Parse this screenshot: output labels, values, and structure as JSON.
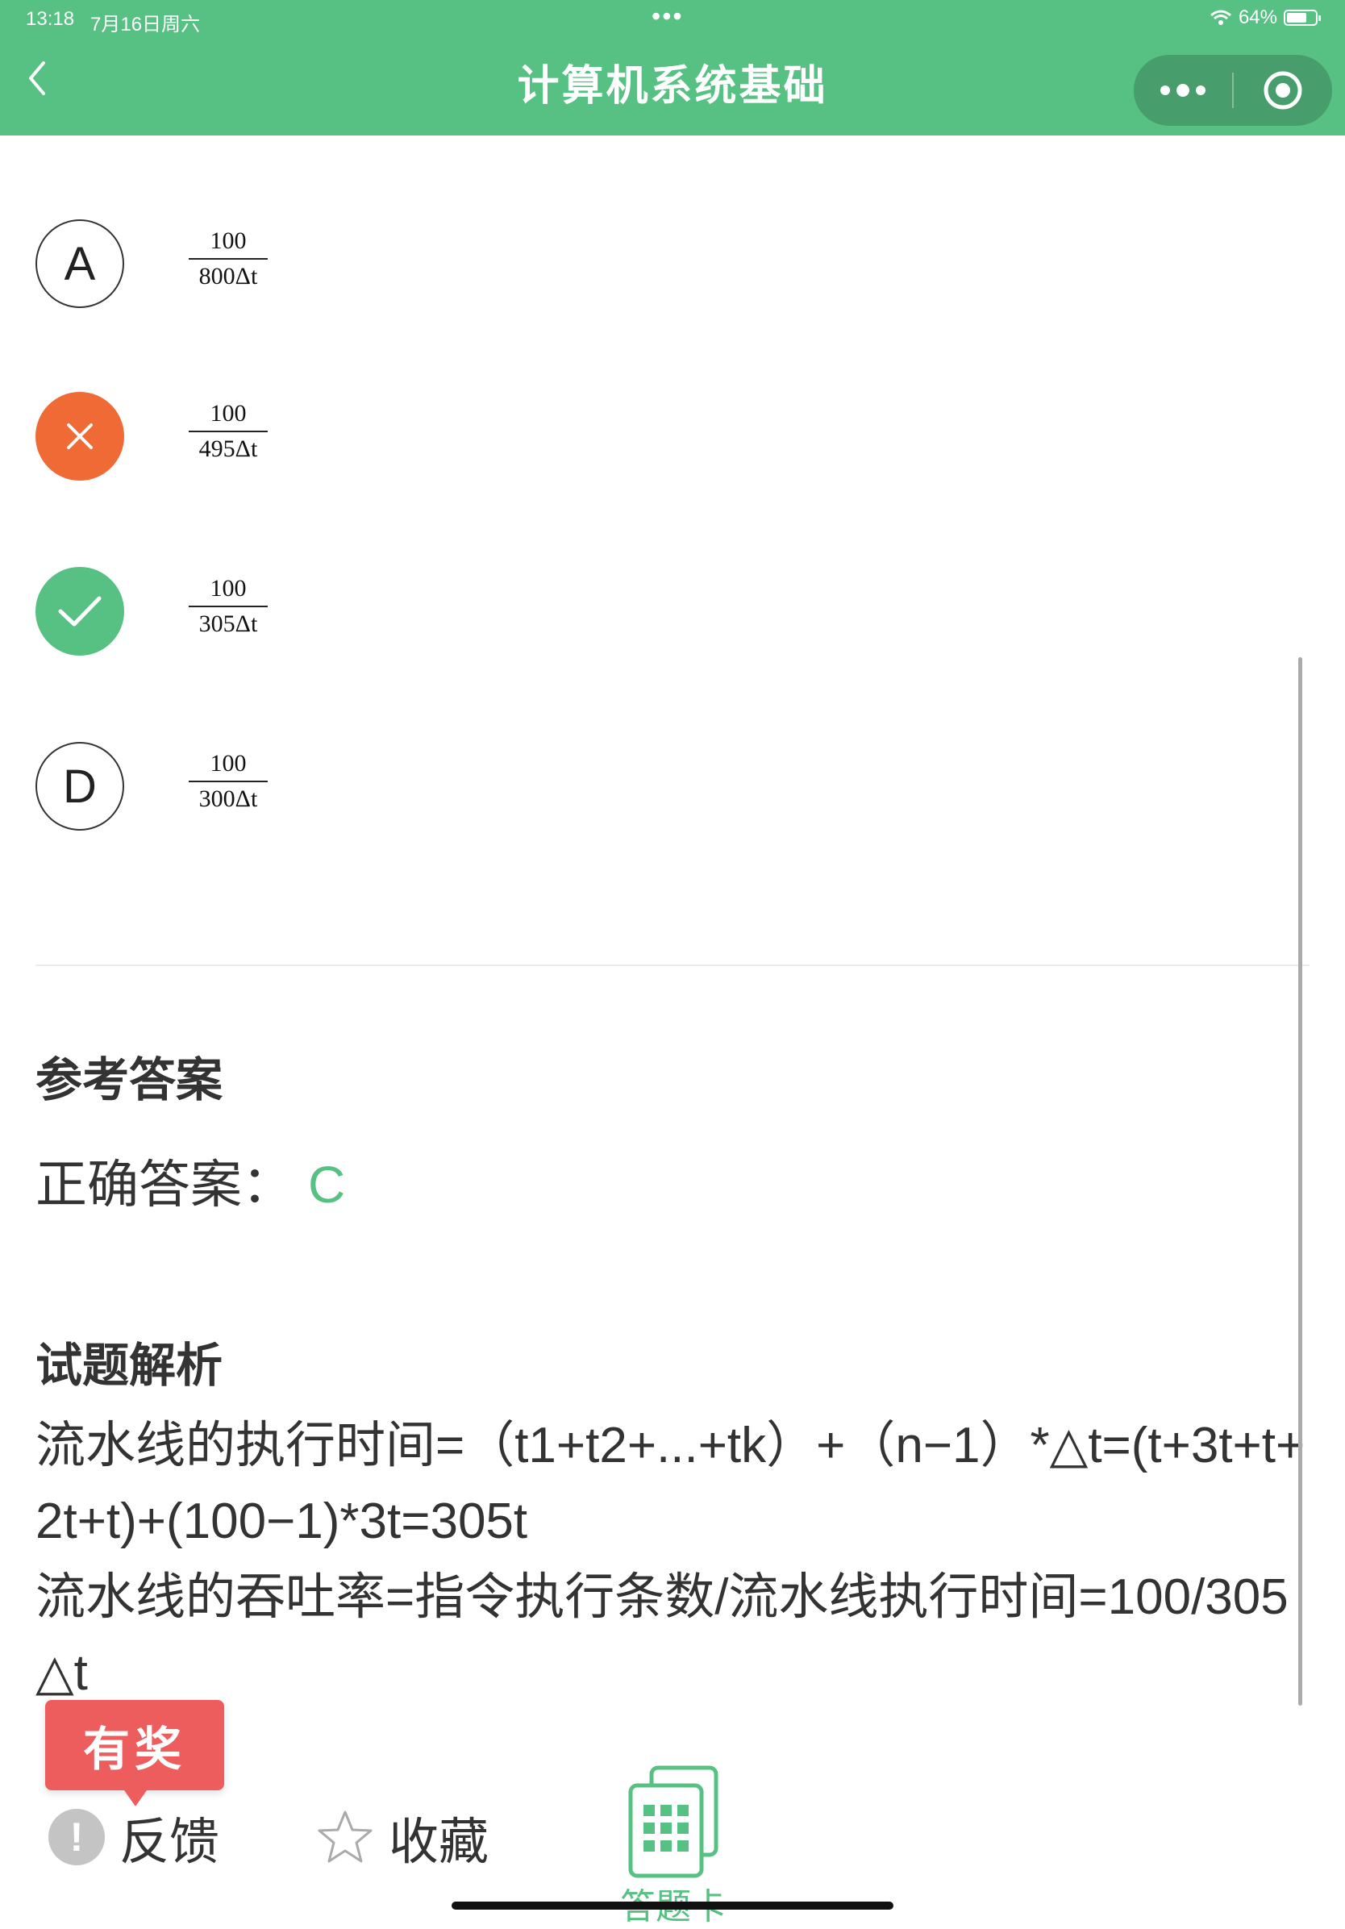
{
  "status_bar": {
    "time": "13:18",
    "date": "7月16日周六",
    "dots": "•••",
    "battery": "64%"
  },
  "header": {
    "title": "计算机系统基础"
  },
  "options": [
    {
      "marker": "A",
      "state": "plain",
      "numerator": "100",
      "denominator": "800Δt"
    },
    {
      "marker": "",
      "state": "wrong",
      "numerator": "100",
      "denominator": "495Δt"
    },
    {
      "marker": "",
      "state": "correct",
      "numerator": "100",
      "denominator": "305Δt"
    },
    {
      "marker": "D",
      "state": "plain",
      "numerator": "100",
      "denominator": "300Δt"
    }
  ],
  "reference": {
    "title": "参考答案",
    "label": "正确答案：",
    "answer": "C"
  },
  "analysis": {
    "title": "试题解析",
    "line1": "流水线的执行时间=（t1+t2+...+tk）+（n−1）*△t=(t+3t+t+2t+t)+(100−1)*3t=305t",
    "line2": "流水线的吞吐率=指令执行条数/流水线执行时间=100/305△t"
  },
  "bottom_bar": {
    "reward": "有奖",
    "feedback": "反馈",
    "favorite": "收藏",
    "answer_card": "答题卡"
  },
  "colors": {
    "brand_green": "#57c083",
    "wrong_orange": "#ef6a35",
    "reward_red": "#ee5d5d"
  }
}
